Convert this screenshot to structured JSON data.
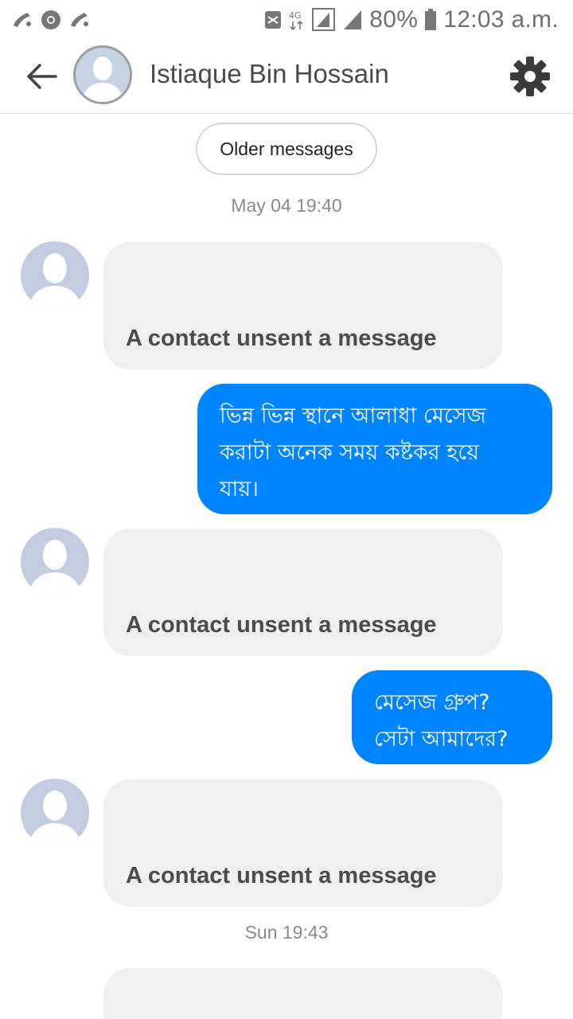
{
  "status_bar": {
    "battery": "80%",
    "time": "12:03 a.m.",
    "network": "4G",
    "left_icons": [
      "carrier-icon",
      "chrome-icon",
      "carrier-icon"
    ],
    "right_icons": [
      "message-icon",
      "4g-icon",
      "signal-icon",
      "signal-icon",
      "battery-icon"
    ]
  },
  "header": {
    "contact_name": "Istiaque Bin Hossain",
    "back_icon": "arrow-left-icon",
    "settings_icon": "gear-icon"
  },
  "chat": {
    "older_messages_label": "Older messages",
    "timestamps": [
      "May 04 19:40",
      "Sun 19:43"
    ],
    "unsent_label": "A contact unsent a message",
    "outgoing": [
      {
        "lines": [
          "ভিন্ন ভিন্ন স্থানে আলাধা মেসেজ",
          "করাটা অনেক সময় কষ্টকর হয়ে",
          "যায়।"
        ]
      },
      {
        "lines": [
          "মেসেজ গ্রুপ?",
          "সেটা আমাদের?"
        ]
      }
    ]
  },
  "colors": {
    "accent": "#0084ff",
    "incoming_bubble": "#f0f0f0",
    "avatar": "#c3cce0"
  }
}
